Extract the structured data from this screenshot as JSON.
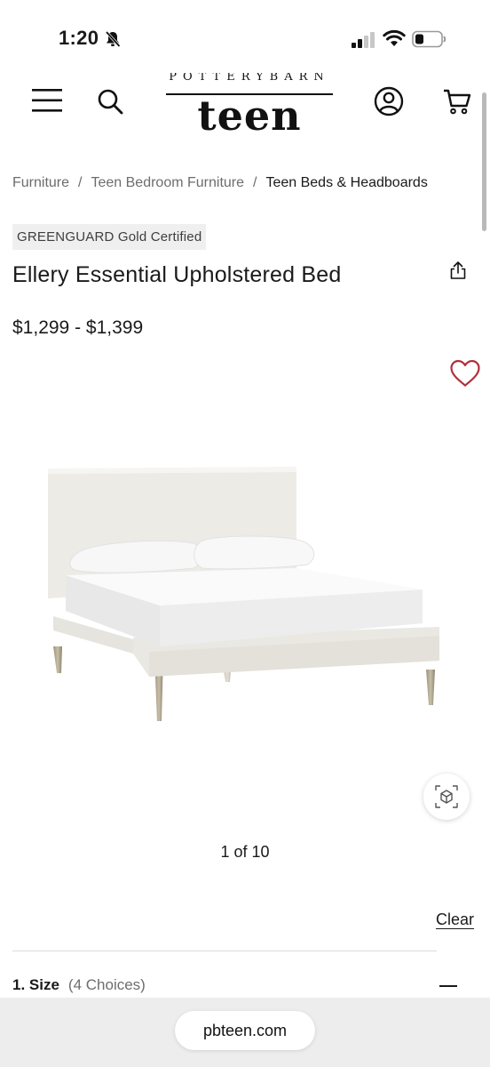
{
  "status_bar": {
    "time": "1:20",
    "icons": [
      "bell-slash-icon",
      "cellular-signal-icon",
      "wifi-icon",
      "battery-icon"
    ]
  },
  "header": {
    "logo_top_text": "POTTERYBARN",
    "logo_main_text": "teen",
    "icons": [
      "hamburger-menu-icon",
      "search-icon",
      "account-icon",
      "cart-icon"
    ]
  },
  "breadcrumb": {
    "items": [
      {
        "label": "Furniture"
      },
      {
        "label": "Teen Bedroom Furniture"
      },
      {
        "label": "Teen Beds & Headboards"
      }
    ],
    "separator": "/"
  },
  "product": {
    "badge": "GREENGUARD Gold Certified",
    "title": "Ellery Essential Upholstered Bed",
    "price": "$1,299 - $1,399",
    "image_counter": "1 of 10",
    "favorite_color": "#b0303a"
  },
  "options": {
    "clear_label": "Clear",
    "size_label": "1. Size",
    "size_choices": "(4 Choices)"
  },
  "browser": {
    "url": "pbteen.com"
  }
}
